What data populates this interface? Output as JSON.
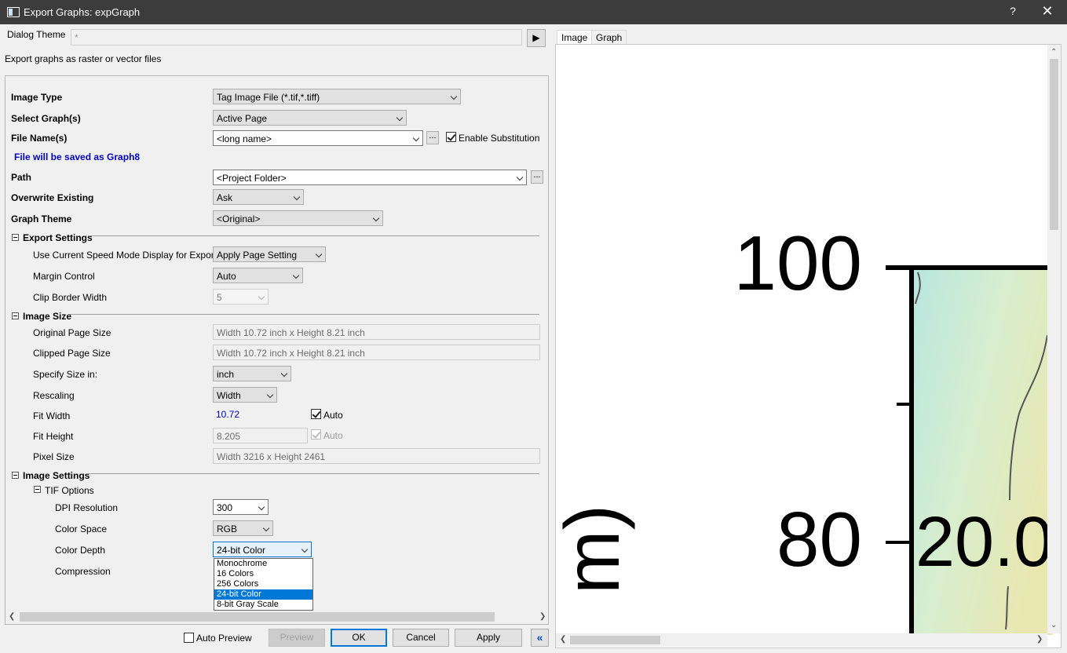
{
  "window": {
    "title": "Export Graphs: expGraph",
    "help": "?",
    "close": "✕"
  },
  "dialog_theme": {
    "label": "Dialog Theme",
    "value": "*",
    "arrow": "▶"
  },
  "description": "Export graphs as raster or vector files",
  "form": {
    "image_type": {
      "label": "Image Type",
      "value": "Tag Image File (*.tif,*.tiff)"
    },
    "select_graphs": {
      "label": "Select Graph(s)",
      "value": "Active Page"
    },
    "file_names": {
      "label": "File Name(s)",
      "value": "<long name>",
      "browse": "...",
      "substitution_label": "Enable Substitution",
      "substitution_checked": true
    },
    "save_note": "File will be saved as Graph8",
    "path": {
      "label": "Path",
      "value": "<Project Folder>",
      "browse": "..."
    },
    "overwrite": {
      "label": "Overwrite Existing",
      "value": "Ask"
    },
    "graph_theme": {
      "label": "Graph Theme",
      "value": "<Original>"
    }
  },
  "export_settings": {
    "header": "Export Settings",
    "speed_mode": {
      "label": "Use Current Speed Mode Display for Export",
      "value": "Apply Page Setting"
    },
    "margin": {
      "label": "Margin Control",
      "value": "Auto"
    },
    "clip_border": {
      "label": "Clip Border Width",
      "value": "5"
    }
  },
  "image_size": {
    "header": "Image Size",
    "original": {
      "label": "Original Page Size",
      "value": "Width 10.72 inch x Height 8.21 inch"
    },
    "clipped": {
      "label": "Clipped Page Size",
      "value": "Width 10.72 inch x Height 8.21 inch"
    },
    "specify": {
      "label": "Specify Size in:",
      "value": "inch"
    },
    "rescaling": {
      "label": "Rescaling",
      "value": "Width"
    },
    "fit_width": {
      "label": "Fit Width",
      "value": "10.72",
      "auto_label": "Auto",
      "auto_checked": true
    },
    "fit_height": {
      "label": "Fit Height",
      "value": "8.205",
      "auto_label": "Auto",
      "auto_checked": true
    },
    "pixel": {
      "label": "Pixel Size",
      "value": "Width 3216 x Height 2461"
    }
  },
  "image_settings": {
    "header": "Image Settings",
    "tif_header": "TIF Options",
    "dpi": {
      "label": "DPI Resolution",
      "value": "300"
    },
    "color_space": {
      "label": "Color Space",
      "value": "RGB"
    },
    "color_depth": {
      "label": "Color Depth",
      "value": "24-bit Color",
      "options": [
        "Monochrome",
        "16 Colors",
        "256 Colors",
        "24-bit Color",
        "8-bit Gray Scale"
      ],
      "selected_index": 3
    },
    "compression": {
      "label": "Compression"
    }
  },
  "footer": {
    "auto_preview": "Auto Preview",
    "auto_preview_checked": false,
    "preview": "Preview",
    "ok": "OK",
    "cancel": "Cancel",
    "apply": "Apply",
    "collapse": "«"
  },
  "preview": {
    "tabs": [
      "Image",
      "Graph"
    ],
    "active_tab": 0,
    "tick_labels": [
      "100",
      "80"
    ],
    "axis_title_fragment": "m)",
    "contour_label": "20.0"
  },
  "colors": {
    "accent": "#0078d7",
    "note_blue": "#0000c8",
    "titlebar": "#3c3c3c"
  }
}
